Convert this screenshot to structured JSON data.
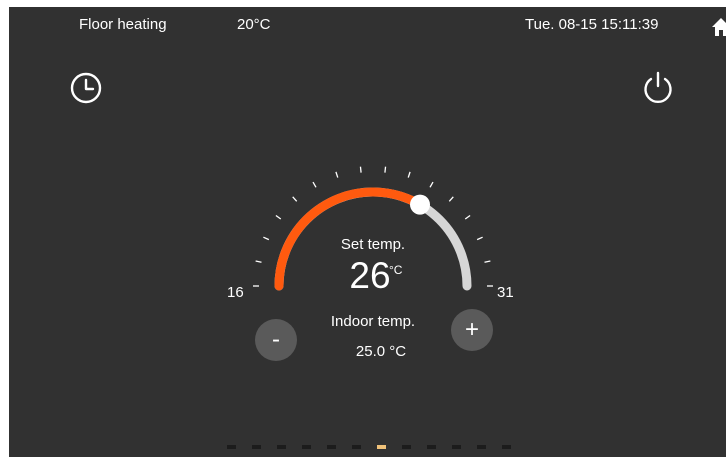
{
  "status_bar": {
    "mode_label": "Floor heating",
    "room_temperature": "20°C",
    "datetime": "Tue. 08-15 15:11:39",
    "home_icon": "home-icon"
  },
  "controls": {
    "timer_icon": "clock-icon",
    "power_icon": "power-icon"
  },
  "thermostat": {
    "set_label": "Set temp.",
    "set_value": "26",
    "set_unit": "°C",
    "indoor_label": "Indoor temp.",
    "indoor_value": "25.0 °C",
    "min": 16,
    "max": 31,
    "setpoint": 26,
    "min_label": "16",
    "max_label": "31",
    "decrease_label": "-",
    "increase_label": "+",
    "active_color": "#ff5a0f",
    "track_color": "#d6d6d6",
    "knob_color": "#ffffff"
  },
  "pager": {
    "count": 12,
    "active_index": 6,
    "active_color": "#f0c27a",
    "inactive_color": "#1c1c1c"
  }
}
